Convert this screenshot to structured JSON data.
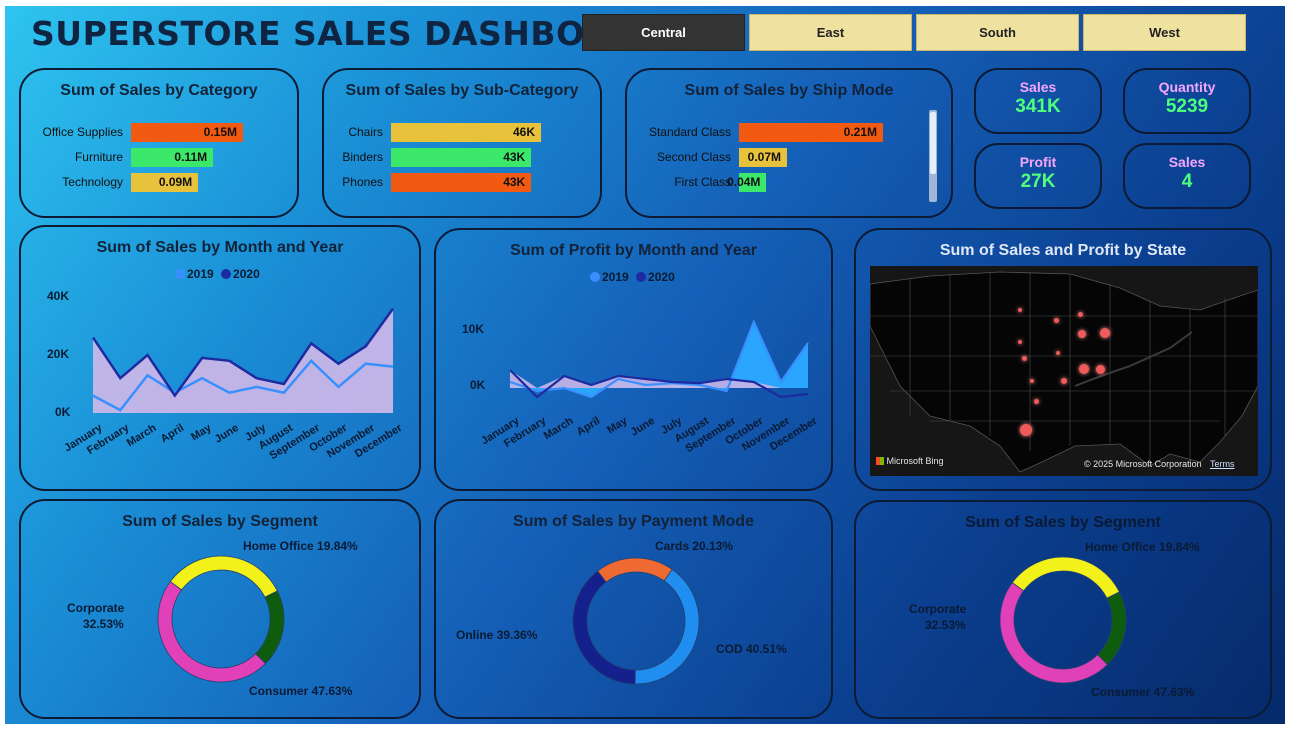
{
  "header": {
    "title": "SUPERSTORE SALES DASHBOARD"
  },
  "region_slicer": {
    "options": [
      "Central",
      "East",
      "South",
      "West"
    ],
    "selected": "Central"
  },
  "colors": {
    "orange": "#f25a12",
    "green": "#3ce86a",
    "yellow": "#e8c23a",
    "line_2019": "#3a8fff",
    "line_2020": "#1d2aa0",
    "area": "#c9b6e8",
    "kpi_label": "#f6a6ff",
    "kpi_value": "#4dff7a"
  },
  "category_chart": {
    "title": "Sum of Sales by Category",
    "rows": [
      {
        "label": "Office Supplies",
        "value": 0.15,
        "display": "0.15M",
        "color": "#f25a12"
      },
      {
        "label": "Furniture",
        "value": 0.11,
        "display": "0.11M",
        "color": "#3ce86a"
      },
      {
        "label": "Technology",
        "value": 0.09,
        "display": "0.09M",
        "color": "#e8c23a"
      }
    ]
  },
  "subcategory_chart": {
    "title": "Sum of Sales by Sub-Category",
    "rows": [
      {
        "label": "Chairs",
        "value": 46,
        "display": "46K",
        "color": "#e8c23a"
      },
      {
        "label": "Binders",
        "value": 43,
        "display": "43K",
        "color": "#3ce86a"
      },
      {
        "label": "Phones",
        "value": 43,
        "display": "43K",
        "color": "#f25a12"
      }
    ]
  },
  "shipmode_chart": {
    "title": "Sum of Sales by Ship Mode",
    "rows": [
      {
        "label": "Standard Class",
        "value": 0.21,
        "display": "0.21M",
        "color": "#f25a12"
      },
      {
        "label": "Second Class",
        "value": 0.07,
        "display": "0.07M",
        "color": "#e8c23a"
      },
      {
        "label": "First Class",
        "value": 0.04,
        "display": "0.04M",
        "color": "#3ce86a"
      }
    ]
  },
  "kpis": [
    {
      "label": "Sales",
      "value": "341K"
    },
    {
      "label": "Quantity",
      "value": "5239"
    },
    {
      "label": "Profit",
      "value": "27K"
    },
    {
      "label": "Sales",
      "value": "4"
    }
  ],
  "sales_month": {
    "title": "Sum of Sales by Month and Year",
    "legend": [
      "2019",
      "2020"
    ],
    "yticks": [
      "40K",
      "20K",
      "0K"
    ]
  },
  "profit_month": {
    "title": "Sum of Profit by Month and Year",
    "legend": [
      "2019",
      "2020"
    ],
    "yticks": [
      "10K",
      "0K"
    ]
  },
  "months": [
    "January",
    "February",
    "March",
    "April",
    "May",
    "June",
    "July",
    "August",
    "September",
    "October",
    "November",
    "December"
  ],
  "map": {
    "title": "Sum of Sales and Profit by State",
    "attribution": "Microsoft Bing",
    "copyright": "© 2025 Microsoft Corporation",
    "terms": "Terms"
  },
  "segment_chart_1": {
    "title": "Sum of Sales by Segment",
    "labels": {
      "home": "Home Office 19.84%",
      "corp1": "Corporate",
      "corp2": "32.53%",
      "cons": "Consumer 47.63%"
    }
  },
  "payment_chart": {
    "title": "Sum of Sales by Payment Mode",
    "labels": {
      "cards": "Cards 20.13%",
      "online": "Online 39.36%",
      "cod": "COD 40.51%"
    }
  },
  "segment_chart_2": {
    "title": "Sum of Sales by Segment",
    "labels": {
      "home": "Home Office 19.84%",
      "corp1": "Corporate",
      "corp2": "32.53%",
      "cons": "Consumer 47.63%"
    }
  },
  "chart_data": [
    {
      "type": "bar",
      "title": "Sum of Sales by Category",
      "categories": [
        "Office Supplies",
        "Furniture",
        "Technology"
      ],
      "values": [
        0.15,
        0.11,
        0.09
      ],
      "unit": "M"
    },
    {
      "type": "bar",
      "title": "Sum of Sales by Sub-Category",
      "categories": [
        "Chairs",
        "Binders",
        "Phones"
      ],
      "values": [
        46,
        43,
        43
      ],
      "unit": "K"
    },
    {
      "type": "bar",
      "title": "Sum of Sales by Ship Mode",
      "categories": [
        "Standard Class",
        "Second Class",
        "First Class"
      ],
      "values": [
        0.21,
        0.07,
        0.04
      ],
      "unit": "M"
    },
    {
      "type": "line",
      "title": "Sum of Sales by Month and Year",
      "x": [
        "January",
        "February",
        "March",
        "April",
        "May",
        "June",
        "July",
        "August",
        "September",
        "October",
        "November",
        "December"
      ],
      "ylim": [
        0,
        40000
      ],
      "series": [
        {
          "name": "2019",
          "values": [
            6000,
            1000,
            13000,
            7000,
            12000,
            7000,
            9000,
            7000,
            18000,
            9000,
            17000,
            16000
          ]
        },
        {
          "name": "2020",
          "values": [
            26000,
            12000,
            20000,
            6000,
            19000,
            18000,
            12000,
            10000,
            24000,
            17000,
            23000,
            36000
          ]
        }
      ]
    },
    {
      "type": "area",
      "title": "Sum of Profit by Month and Year",
      "x": [
        "January",
        "February",
        "March",
        "April",
        "May",
        "June",
        "July",
        "August",
        "September",
        "October",
        "November",
        "December"
      ],
      "ylim": [
        -2000,
        12000
      ],
      "series": [
        {
          "name": "2019",
          "values": [
            1000,
            -500,
            0,
            -1500,
            1500,
            500,
            800,
            500,
            -500,
            11000,
            1000,
            7500
          ]
        },
        {
          "name": "2020",
          "values": [
            3000,
            -1500,
            2000,
            500,
            2000,
            1500,
            1000,
            800,
            1500,
            1000,
            -1500,
            -1000
          ]
        }
      ]
    },
    {
      "type": "pie",
      "title": "Sum of Sales by Segment",
      "categories": [
        "Consumer",
        "Corporate",
        "Home Office"
      ],
      "values": [
        47.63,
        32.53,
        19.84
      ]
    },
    {
      "type": "pie",
      "title": "Sum of Sales by Payment Mode",
      "categories": [
        "COD",
        "Online",
        "Cards"
      ],
      "values": [
        40.51,
        39.36,
        20.13
      ]
    },
    {
      "type": "pie",
      "title": "Sum of Sales by Segment",
      "categories": [
        "Consumer",
        "Corporate",
        "Home Office"
      ],
      "values": [
        47.63,
        32.53,
        19.84
      ]
    }
  ]
}
